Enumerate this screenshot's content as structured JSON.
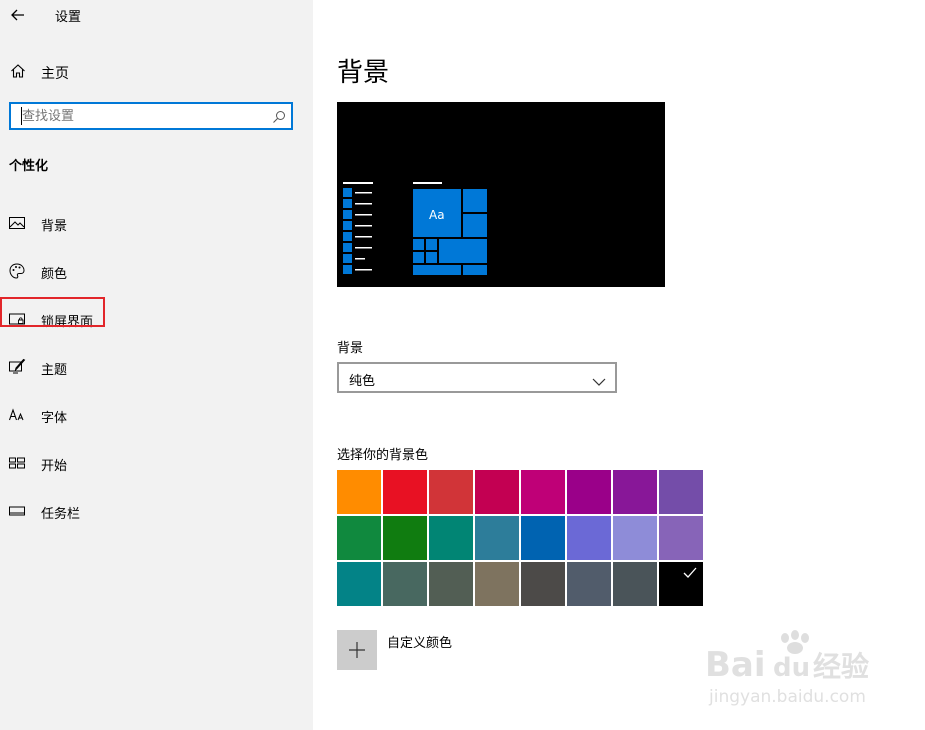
{
  "window": {
    "title": "设置"
  },
  "sidebar": {
    "home_label": "主页",
    "search_placeholder": "查找设置",
    "section_title": "个性化",
    "items": [
      {
        "label": "背景",
        "icon": "picture-icon"
      },
      {
        "label": "颜色",
        "icon": "palette-icon"
      },
      {
        "label": "锁屏界面",
        "icon": "lock-screen-icon",
        "highlighted": true
      },
      {
        "label": "主题",
        "icon": "theme-brush-icon"
      },
      {
        "label": "字体",
        "icon": "font-icon"
      },
      {
        "label": "开始",
        "icon": "start-grid-icon"
      },
      {
        "label": "任务栏",
        "icon": "taskbar-icon"
      }
    ]
  },
  "main": {
    "title": "背景",
    "preview_tile_text": "Aa",
    "background_field_label": "背景",
    "background_value": "纯色",
    "color_picker_label": "选择你的背景色",
    "colors": [
      "#ff8c00",
      "#e81123",
      "#d13438",
      "#c30052",
      "#bf0077",
      "#9a0089",
      "#881798",
      "#744da9",
      "#10893e",
      "#107c10",
      "#018574",
      "#2d7d9a",
      "#0063b1",
      "#6b69d6",
      "#8e8cd8",
      "#8764b8",
      "#038387",
      "#486860",
      "#525e54",
      "#7e735f",
      "#4c4a48",
      "#515c6b",
      "#4a5459",
      "#000000"
    ],
    "selected_color_index": 23,
    "custom_color_label": "自定义颜色"
  },
  "theme": {
    "accent": "#0078d7",
    "highlight_border": "#e2262a"
  },
  "watermark": {
    "brand": "Baidu经验",
    "url": "jingyan.baidu.com"
  }
}
